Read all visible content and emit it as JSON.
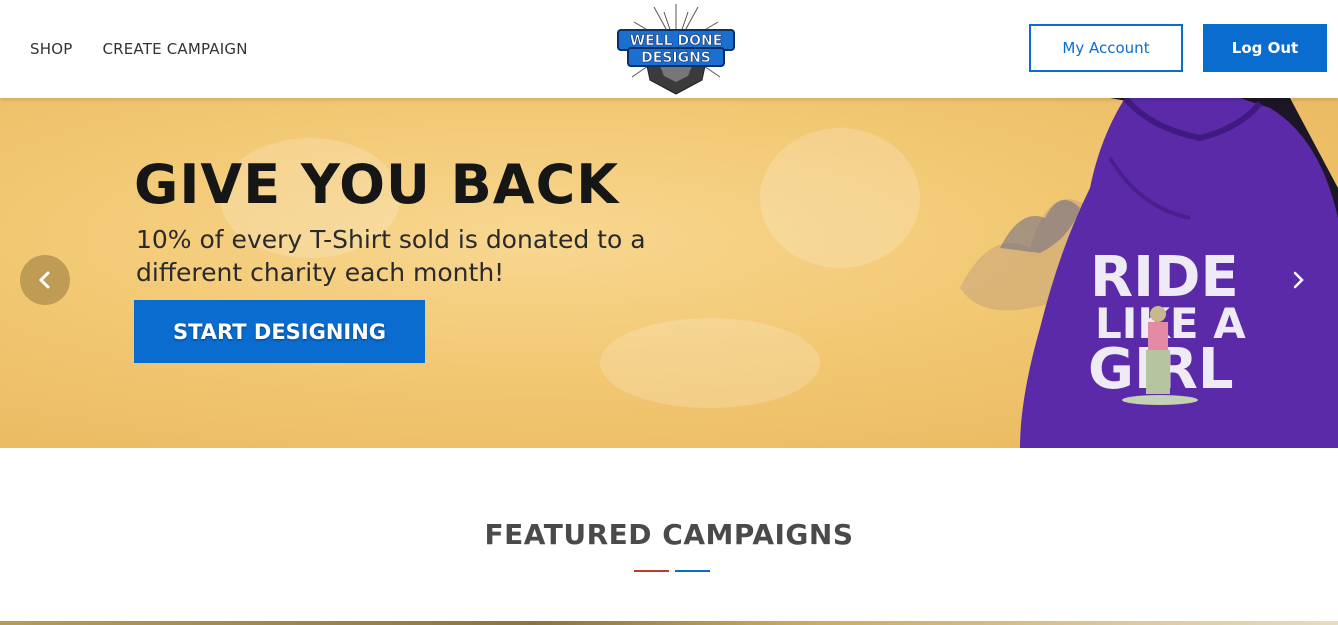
{
  "header": {
    "nav": [
      {
        "label": "SHOP"
      },
      {
        "label": "CREATE CAMPAIGN"
      }
    ],
    "logo": {
      "line1": "WELL DONE",
      "line2": "DESIGNS"
    },
    "account_label": "My Account",
    "logout_label": "Log Out"
  },
  "hero": {
    "title": "GIVE YOU BACK",
    "subtitle": "10% of every T-Shirt sold is donated to a different charity each month!",
    "cta_label": "START DESIGNING",
    "prev_icon": "chevron-left-icon",
    "next_icon": "chevron-right-icon",
    "hoodie_text": [
      "RIDE",
      "LIKE A",
      "GIRL"
    ]
  },
  "featured": {
    "title": "FEATURED CAMPAIGNS"
  },
  "colors": {
    "accent": "#0a6ccf",
    "hero_bg": "#f2c873",
    "hoodie": "#5b2aa8",
    "underline_left": "#c0392b",
    "underline_right": "#0a6ccf"
  }
}
